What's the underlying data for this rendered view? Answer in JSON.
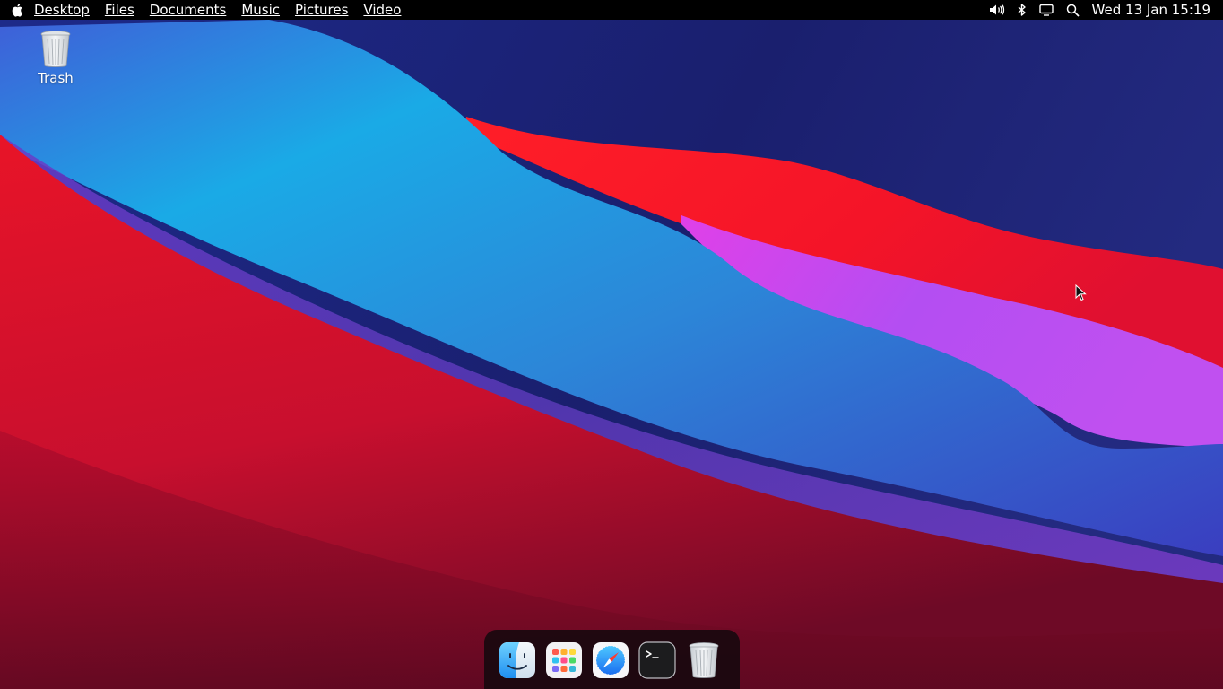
{
  "menubar": {
    "apple_icon": "apple-icon",
    "items": [
      "Desktop",
      "Files",
      "Documents",
      "Music",
      "Pictures",
      "Video"
    ],
    "tray_icons": [
      "volume-icon",
      "bluetooth-icon",
      "display-icon",
      "search-icon"
    ],
    "clock": "Wed 13 Jan  15:19"
  },
  "desktop": {
    "icons": [
      {
        "label": "Trash",
        "icon": "trash-icon"
      }
    ]
  },
  "dock": {
    "items": [
      {
        "name": "finder",
        "icon": "finder-icon"
      },
      {
        "name": "launchpad",
        "icon": "launchpad-icon"
      },
      {
        "name": "safari",
        "icon": "safari-icon"
      },
      {
        "name": "terminal",
        "icon": "terminal-icon"
      },
      {
        "name": "trash",
        "icon": "trash-icon"
      }
    ]
  },
  "colors": {
    "menubar_bg": "#000000",
    "wallpaper_navy": "#1a2070",
    "wallpaper_cyan": "#1aa8e8",
    "wallpaper_red": "#ff1a2a",
    "wallpaper_magenta": "#b040f0",
    "wallpaper_crimson": "#8a0a2a"
  }
}
